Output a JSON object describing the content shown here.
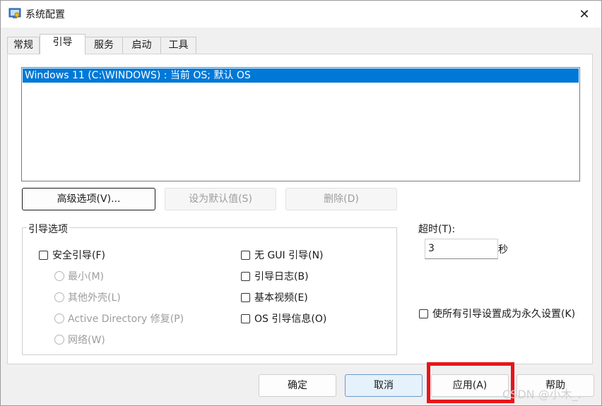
{
  "window": {
    "title": "系统配置",
    "close_glyph": "✕"
  },
  "tabs": [
    {
      "label": "常规",
      "active": false
    },
    {
      "label": "引导",
      "active": true
    },
    {
      "label": "服务",
      "active": false
    },
    {
      "label": "启动",
      "active": false
    },
    {
      "label": "工具",
      "active": false
    }
  ],
  "os_list": {
    "items": [
      "Windows 11 (C:\\WINDOWS) : 当前 OS; 默认 OS"
    ],
    "selected_index": 0
  },
  "boot_buttons": {
    "advanced": "高级选项(V)...",
    "set_default": "设为默认值(S)",
    "delete": "删除(D)"
  },
  "boot_options": {
    "title": "引导选项",
    "safe_boot": "安全引导(F)",
    "minimal": "最小(M)",
    "alternate_shell": "其他外壳(L)",
    "active_directory": "Active Directory 修复(P)",
    "network": "网络(W)",
    "no_gui": "无 GUI 引导(N)",
    "boot_log": "引导日志(B)",
    "base_video": "基本视频(E)",
    "os_boot_info": "OS 引导信息(O)"
  },
  "timeout": {
    "label": "超时(T):",
    "value": "3",
    "unit": "秒"
  },
  "make_permanent": "使所有引导设置成为永久设置(K)",
  "footer": {
    "ok": "确定",
    "cancel": "取消",
    "apply": "应用(A)",
    "help": "帮助"
  },
  "watermark": "CSDN @小木_.",
  "colors": {
    "selection": "#0078d7",
    "highlight_box": "#e8141b",
    "default_button": "#e5f1fb"
  }
}
